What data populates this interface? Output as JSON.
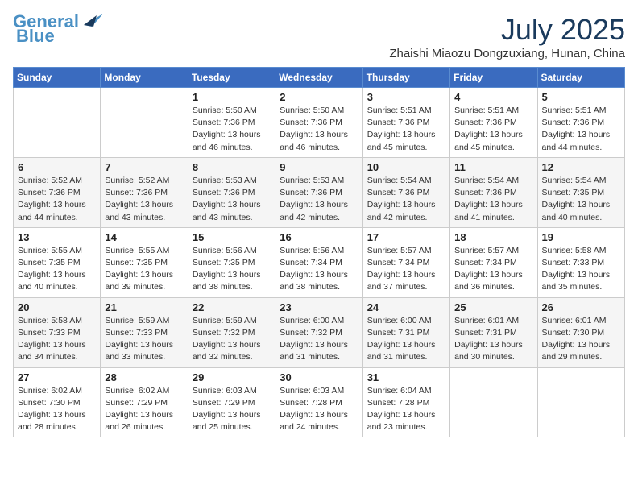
{
  "header": {
    "logo_line1": "General",
    "logo_line2": "Blue",
    "month_year": "July 2025",
    "location": "Zhaishi Miaozu Dongzuxiang, Hunan, China"
  },
  "weekdays": [
    "Sunday",
    "Monday",
    "Tuesday",
    "Wednesday",
    "Thursday",
    "Friday",
    "Saturday"
  ],
  "weeks": [
    [
      {
        "day": "",
        "info": ""
      },
      {
        "day": "",
        "info": ""
      },
      {
        "day": "1",
        "info": "Sunrise: 5:50 AM\nSunset: 7:36 PM\nDaylight: 13 hours and 46 minutes."
      },
      {
        "day": "2",
        "info": "Sunrise: 5:50 AM\nSunset: 7:36 PM\nDaylight: 13 hours and 46 minutes."
      },
      {
        "day": "3",
        "info": "Sunrise: 5:51 AM\nSunset: 7:36 PM\nDaylight: 13 hours and 45 minutes."
      },
      {
        "day": "4",
        "info": "Sunrise: 5:51 AM\nSunset: 7:36 PM\nDaylight: 13 hours and 45 minutes."
      },
      {
        "day": "5",
        "info": "Sunrise: 5:51 AM\nSunset: 7:36 PM\nDaylight: 13 hours and 44 minutes."
      }
    ],
    [
      {
        "day": "6",
        "info": "Sunrise: 5:52 AM\nSunset: 7:36 PM\nDaylight: 13 hours and 44 minutes."
      },
      {
        "day": "7",
        "info": "Sunrise: 5:52 AM\nSunset: 7:36 PM\nDaylight: 13 hours and 43 minutes."
      },
      {
        "day": "8",
        "info": "Sunrise: 5:53 AM\nSunset: 7:36 PM\nDaylight: 13 hours and 43 minutes."
      },
      {
        "day": "9",
        "info": "Sunrise: 5:53 AM\nSunset: 7:36 PM\nDaylight: 13 hours and 42 minutes."
      },
      {
        "day": "10",
        "info": "Sunrise: 5:54 AM\nSunset: 7:36 PM\nDaylight: 13 hours and 42 minutes."
      },
      {
        "day": "11",
        "info": "Sunrise: 5:54 AM\nSunset: 7:36 PM\nDaylight: 13 hours and 41 minutes."
      },
      {
        "day": "12",
        "info": "Sunrise: 5:54 AM\nSunset: 7:35 PM\nDaylight: 13 hours and 40 minutes."
      }
    ],
    [
      {
        "day": "13",
        "info": "Sunrise: 5:55 AM\nSunset: 7:35 PM\nDaylight: 13 hours and 40 minutes."
      },
      {
        "day": "14",
        "info": "Sunrise: 5:55 AM\nSunset: 7:35 PM\nDaylight: 13 hours and 39 minutes."
      },
      {
        "day": "15",
        "info": "Sunrise: 5:56 AM\nSunset: 7:35 PM\nDaylight: 13 hours and 38 minutes."
      },
      {
        "day": "16",
        "info": "Sunrise: 5:56 AM\nSunset: 7:34 PM\nDaylight: 13 hours and 38 minutes."
      },
      {
        "day": "17",
        "info": "Sunrise: 5:57 AM\nSunset: 7:34 PM\nDaylight: 13 hours and 37 minutes."
      },
      {
        "day": "18",
        "info": "Sunrise: 5:57 AM\nSunset: 7:34 PM\nDaylight: 13 hours and 36 minutes."
      },
      {
        "day": "19",
        "info": "Sunrise: 5:58 AM\nSunset: 7:33 PM\nDaylight: 13 hours and 35 minutes."
      }
    ],
    [
      {
        "day": "20",
        "info": "Sunrise: 5:58 AM\nSunset: 7:33 PM\nDaylight: 13 hours and 34 minutes."
      },
      {
        "day": "21",
        "info": "Sunrise: 5:59 AM\nSunset: 7:33 PM\nDaylight: 13 hours and 33 minutes."
      },
      {
        "day": "22",
        "info": "Sunrise: 5:59 AM\nSunset: 7:32 PM\nDaylight: 13 hours and 32 minutes."
      },
      {
        "day": "23",
        "info": "Sunrise: 6:00 AM\nSunset: 7:32 PM\nDaylight: 13 hours and 31 minutes."
      },
      {
        "day": "24",
        "info": "Sunrise: 6:00 AM\nSunset: 7:31 PM\nDaylight: 13 hours and 31 minutes."
      },
      {
        "day": "25",
        "info": "Sunrise: 6:01 AM\nSunset: 7:31 PM\nDaylight: 13 hours and 30 minutes."
      },
      {
        "day": "26",
        "info": "Sunrise: 6:01 AM\nSunset: 7:30 PM\nDaylight: 13 hours and 29 minutes."
      }
    ],
    [
      {
        "day": "27",
        "info": "Sunrise: 6:02 AM\nSunset: 7:30 PM\nDaylight: 13 hours and 28 minutes."
      },
      {
        "day": "28",
        "info": "Sunrise: 6:02 AM\nSunset: 7:29 PM\nDaylight: 13 hours and 26 minutes."
      },
      {
        "day": "29",
        "info": "Sunrise: 6:03 AM\nSunset: 7:29 PM\nDaylight: 13 hours and 25 minutes."
      },
      {
        "day": "30",
        "info": "Sunrise: 6:03 AM\nSunset: 7:28 PM\nDaylight: 13 hours and 24 minutes."
      },
      {
        "day": "31",
        "info": "Sunrise: 6:04 AM\nSunset: 7:28 PM\nDaylight: 13 hours and 23 minutes."
      },
      {
        "day": "",
        "info": ""
      },
      {
        "day": "",
        "info": ""
      }
    ]
  ]
}
